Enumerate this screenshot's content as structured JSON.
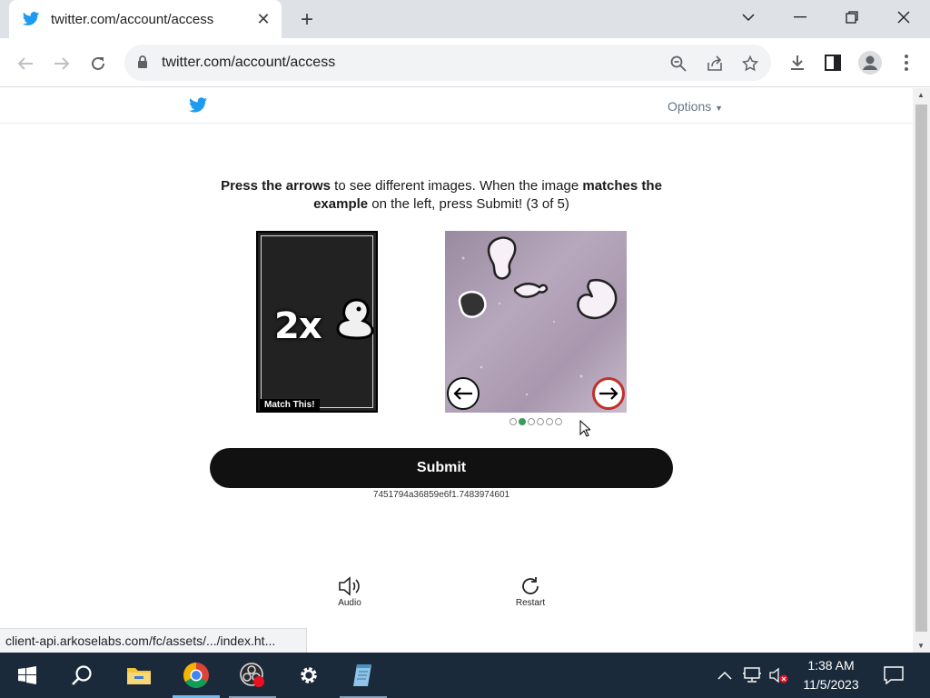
{
  "browser": {
    "tab_title": "twitter.com/account/access",
    "url": "twitter.com/account/access",
    "status_url": "client-api.arkoselabs.com/fc/assets/.../index.ht..."
  },
  "page": {
    "options_label": "Options",
    "instructions": {
      "part1_bold": "Press the arrows",
      "part2": " to see different images. When the image ",
      "part3_bold": "matches the example",
      "part4": " on the left, press Submit! (3 of 5)"
    },
    "example_label": "Match This!",
    "example_text": "2x",
    "gallery": {
      "dots_total": 6,
      "active_dot": 1
    },
    "submit_label": "Submit",
    "session_id": "7451794a36859e6f1.7483974601",
    "audio_label": "Audio",
    "restart_label": "Restart"
  },
  "taskbar": {
    "time": "1:38 AM",
    "date": "11/5/2023"
  },
  "colors": {
    "twitter_blue": "#1d9bf0",
    "submit_bg": "#111111",
    "active_dot": "#3a9c5a",
    "next_arrow_ring": "#c0312c"
  }
}
